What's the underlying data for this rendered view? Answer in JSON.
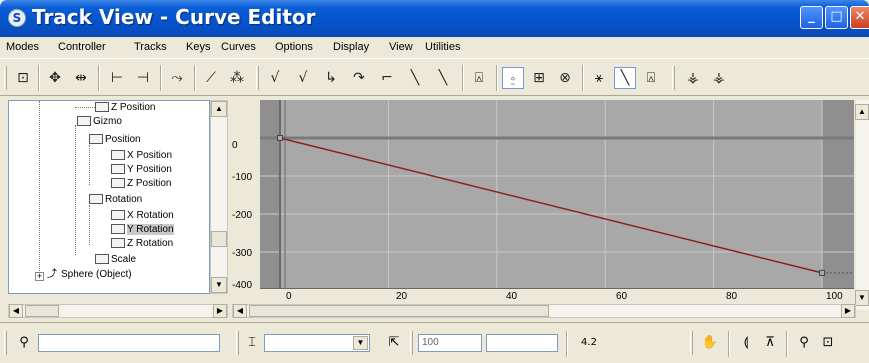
{
  "window": {
    "title": "Track View - Curve Editor",
    "icon": "app-logo-icon"
  },
  "menu": [
    "Modes",
    "Controller",
    "Tracks",
    "Keys",
    "Curves",
    "Options",
    "Display",
    "View",
    "Utilities"
  ],
  "tree": {
    "items": [
      {
        "label": "Z Position",
        "icon": "track-icon"
      },
      {
        "label": "Gizmo",
        "icon": "gizmo-icon"
      },
      {
        "label": "Position",
        "icon": "position-controller-icon"
      },
      {
        "label": "X Position",
        "icon": "track-icon"
      },
      {
        "label": "Y Position",
        "icon": "track-icon"
      },
      {
        "label": "Z Position",
        "icon": "track-icon"
      },
      {
        "label": "Rotation",
        "icon": "rotation-controller-icon"
      },
      {
        "label": "X Rotation",
        "icon": "track-icon"
      },
      {
        "label": "Y Rotation",
        "icon": "track-icon",
        "selected": true
      },
      {
        "label": "Z Rotation",
        "icon": "track-icon"
      },
      {
        "label": "Scale",
        "icon": "scale-controller-icon"
      },
      {
        "label": "Sphere (Object)",
        "icon": "object-icon"
      }
    ]
  },
  "graph": {
    "y_ticks": [
      "0",
      "-100",
      "-200",
      "-300",
      "-400"
    ],
    "x_ticks": [
      "0",
      "20",
      "40",
      "60",
      "80",
      "100"
    ],
    "curve": {
      "start": [
        0,
        0
      ],
      "end": [
        100,
        -355
      ]
    },
    "colors": {
      "curve": "#8a2020",
      "zero_line": "#7a7a7a",
      "grid": "#c8c8c8",
      "bg": "#a8a8a8",
      "outside": "#8f8f8f"
    }
  },
  "status": {
    "frame_value": "100",
    "lock_label": "4.2"
  }
}
